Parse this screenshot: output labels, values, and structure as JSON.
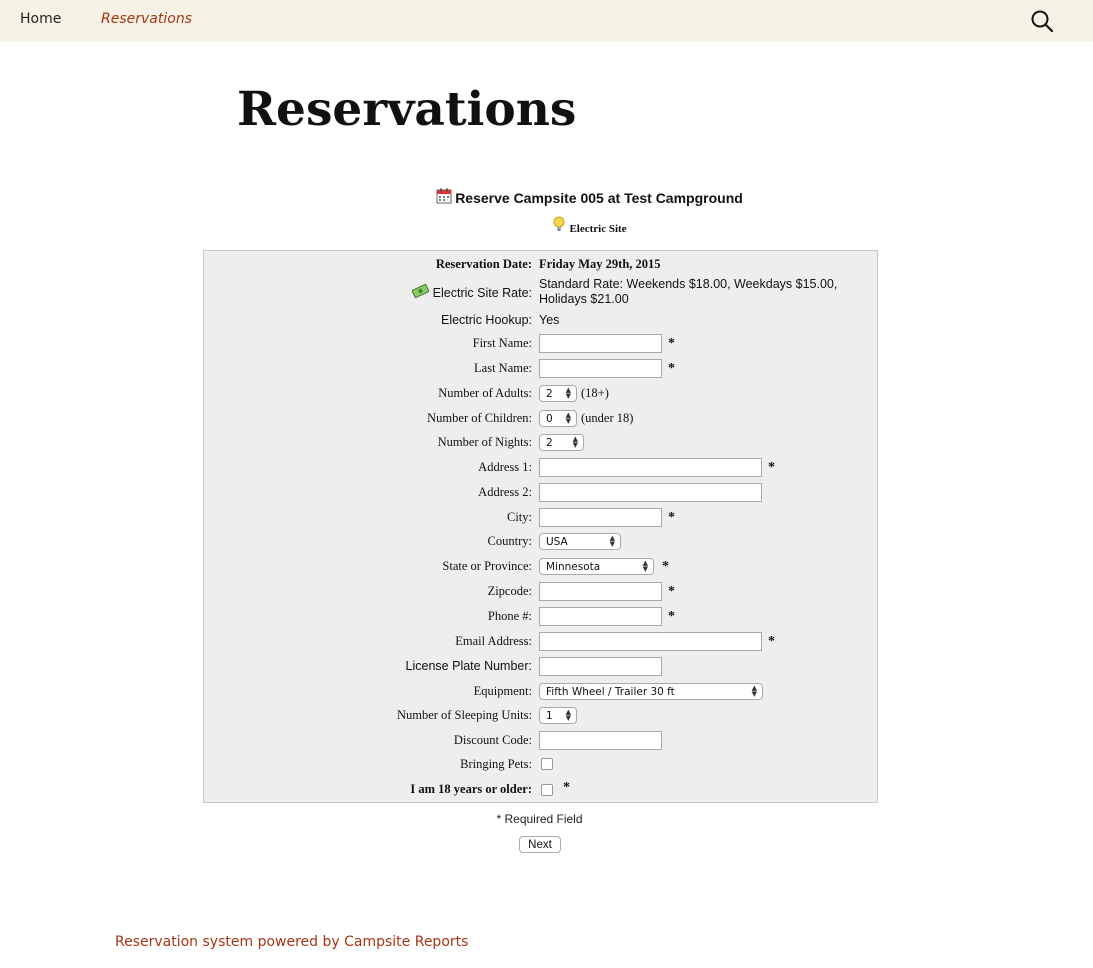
{
  "nav": {
    "home": "Home",
    "reservations": "Reservations"
  },
  "page_title": "Reservations",
  "form": {
    "heading": "Reserve Campsite 005 at Test Campground",
    "site_type": "Electric Site",
    "reservation_date": {
      "label": "Reservation Date:",
      "value": "Friday May 29th, 2015"
    },
    "rate": {
      "label": "Electric Site Rate:",
      "value_line1": "Standard Rate: Weekends $18.00, Weekdays $15.00,",
      "value_line2": "Holidays $21.00"
    },
    "hookup": {
      "label": "Electric Hookup:",
      "value": "Yes"
    },
    "first_name": {
      "label": "First Name:",
      "value": ""
    },
    "last_name": {
      "label": "Last Name:",
      "value": ""
    },
    "adults": {
      "label": "Number of Adults:",
      "value": "2",
      "hint": "(18+)"
    },
    "children": {
      "label": "Number of Children:",
      "value": "0",
      "hint": "(under 18)"
    },
    "nights": {
      "label": "Number of Nights:",
      "value": "2"
    },
    "address1": {
      "label": "Address 1:",
      "value": ""
    },
    "address2": {
      "label": "Address 2:",
      "value": ""
    },
    "city": {
      "label": "City:",
      "value": ""
    },
    "country": {
      "label": "Country:",
      "value": "USA"
    },
    "state": {
      "label": "State or Province:",
      "value": "Minnesota"
    },
    "zipcode": {
      "label": "Zipcode:",
      "value": ""
    },
    "phone": {
      "label": "Phone #:",
      "value": ""
    },
    "email": {
      "label": "Email Address:",
      "value": ""
    },
    "license": {
      "label": "License Plate Number:",
      "value": ""
    },
    "equipment": {
      "label": "Equipment:",
      "value": "Fifth Wheel / Trailer 30 ft"
    },
    "sleeping_units": {
      "label": "Number of Sleeping Units:",
      "value": "1"
    },
    "discount": {
      "label": "Discount Code:",
      "value": ""
    },
    "pets": {
      "label": "Bringing Pets:",
      "checked": false
    },
    "age": {
      "label": "I am 18 years or older:",
      "checked": false
    },
    "required_marker": "*",
    "required_note": "* Required Field",
    "next_button": "Next"
  },
  "footer": {
    "link": "Reservation system powered by Campsite Reports"
  },
  "icons": {
    "search": "search-icon",
    "calendar": "calendar-icon",
    "bulb": "lightbulb-icon",
    "money": "money-icon"
  },
  "colors": {
    "nav_bg": "#f6f3e6",
    "link": "#a63513",
    "form_bg": "#eeeeee"
  }
}
